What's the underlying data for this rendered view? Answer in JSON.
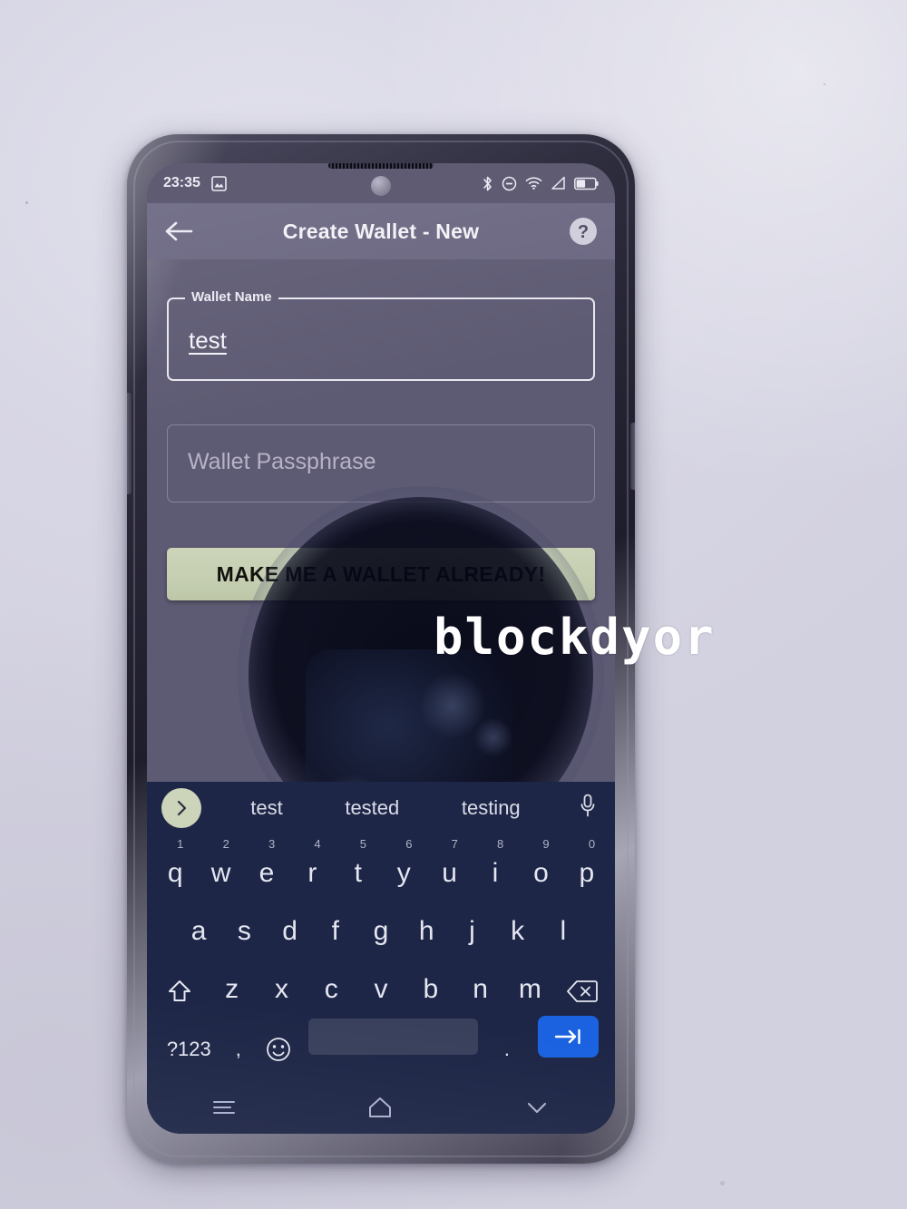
{
  "scene": {
    "background_color": "#dad9e7",
    "device": "android-phone-photo",
    "watermark": "blockdyor"
  },
  "status_bar": {
    "time": "23:35",
    "left_icons": [
      "screenshot-icon"
    ],
    "right_icons": [
      "bluetooth-icon",
      "do-not-disturb-icon",
      "wifi-icon",
      "cellular-signal-icon",
      "battery-icon"
    ]
  },
  "app_bar": {
    "back_label": "back-arrow",
    "title": "Create Wallet - New",
    "help_label": "?"
  },
  "form": {
    "wallet_name": {
      "label": "Wallet Name",
      "value": "test",
      "placeholder": "Wallet Name"
    },
    "wallet_passphrase": {
      "label": "Wallet Passphrase",
      "value": "",
      "placeholder": "Wallet Passphrase"
    },
    "submit_button": {
      "label": "MAKE ME A WALLET ALREADY!",
      "background_color": "#c6cfb2",
      "text_color": "#11120e"
    }
  },
  "keyboard": {
    "suggestions": [
      "test",
      "tested",
      "testing"
    ],
    "expand_icon": "chevron-right-icon",
    "mic_icon": "microphone-icon",
    "row1": [
      {
        "key": "q",
        "num": "1"
      },
      {
        "key": "w",
        "num": "2"
      },
      {
        "key": "e",
        "num": "3"
      },
      {
        "key": "r",
        "num": "4"
      },
      {
        "key": "t",
        "num": "5"
      },
      {
        "key": "y",
        "num": "6"
      },
      {
        "key": "u",
        "num": "7"
      },
      {
        "key": "i",
        "num": "8"
      },
      {
        "key": "o",
        "num": "9"
      },
      {
        "key": "p",
        "num": "0"
      }
    ],
    "row2": [
      "a",
      "s",
      "d",
      "f",
      "g",
      "h",
      "j",
      "k",
      "l"
    ],
    "row3": [
      "z",
      "x",
      "c",
      "v",
      "b",
      "n",
      "m"
    ],
    "shift_icon": "shift-icon",
    "backspace_icon": "backspace-icon",
    "row4": {
      "symbols": "?123",
      "comma": ",",
      "emoji": "emoji-icon",
      "space": "",
      "period": ".",
      "enter": "tab-next-icon",
      "enter_color": "#1a62e0"
    }
  },
  "nav_bar": {
    "recents": "recents-icon",
    "home": "home-icon",
    "dismiss": "chevron-down-icon"
  }
}
